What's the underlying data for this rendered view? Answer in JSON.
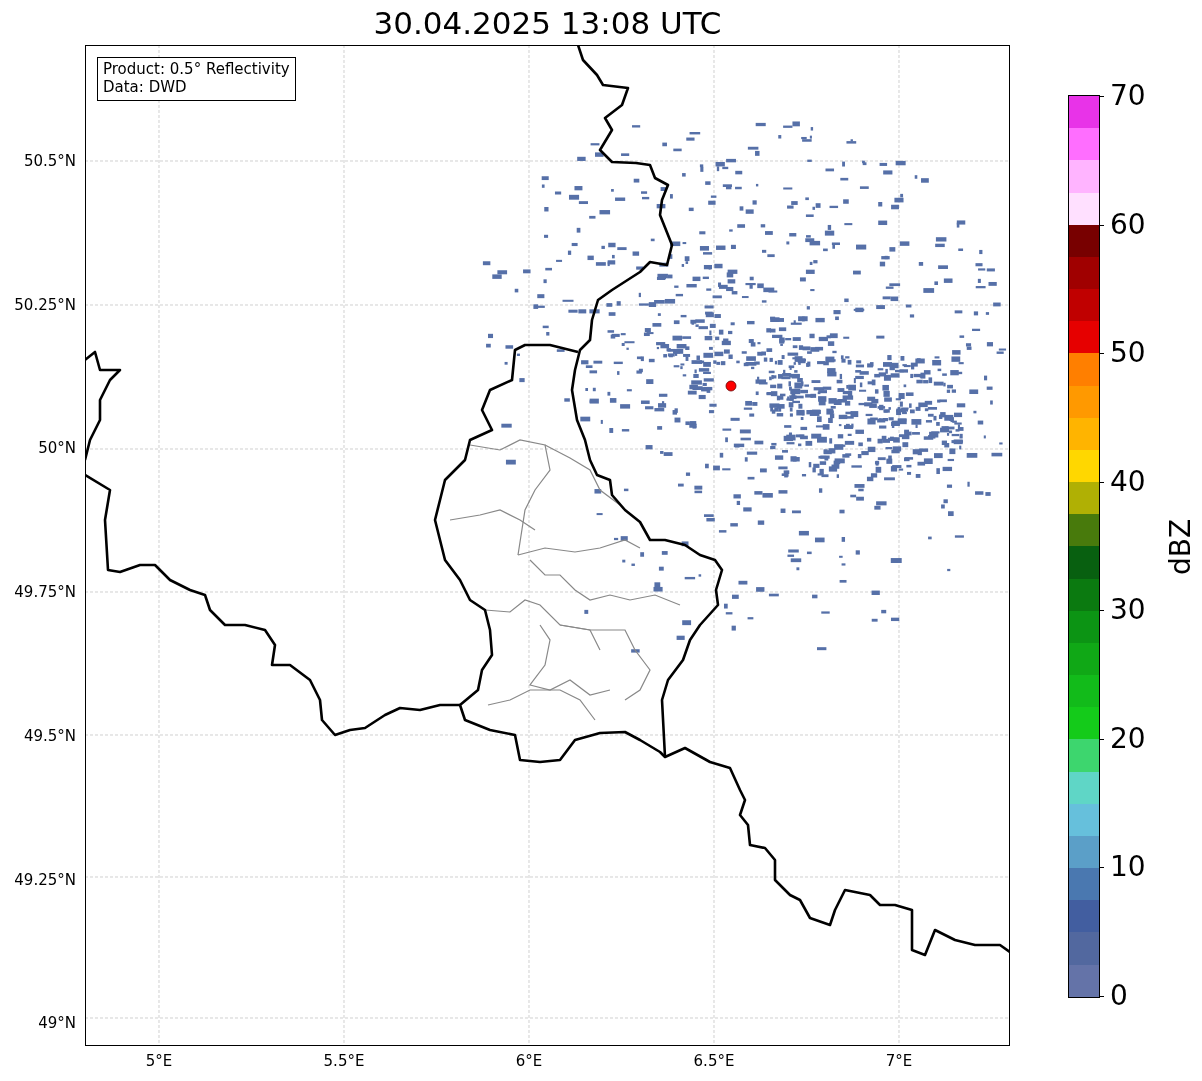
{
  "title": "30.04.2025 13:08 UTC",
  "legend": {
    "lines": [
      "Product: 0.5° Reflectivity",
      "Data: DWD"
    ]
  },
  "map": {
    "x_ticks": [
      "5°E",
      "5.5°E",
      "6°E",
      "6.5°E",
      "7°E"
    ],
    "y_ticks": [
      "50.5°N",
      "50.25°N",
      "50°N",
      "49.75°N",
      "49.5°N",
      "49.25°N",
      "49°N"
    ]
  },
  "colorbar": {
    "label": "dBZ",
    "ticks": [
      "70",
      "60",
      "50",
      "40",
      "30",
      "20",
      "10",
      "0"
    ],
    "segments": [
      {
        "color": "#e833e8"
      },
      {
        "color": "#ff6eff"
      },
      {
        "color": "#ffb4ff"
      },
      {
        "color": "#ffe0ff"
      },
      {
        "color": "#780000"
      },
      {
        "color": "#a00000"
      },
      {
        "color": "#c00000"
      },
      {
        "color": "#e60000"
      },
      {
        "color": "#ff7f00"
      },
      {
        "color": "#ff9900"
      },
      {
        "color": "#ffb400"
      },
      {
        "color": "#ffd700"
      },
      {
        "color": "#b0b004"
      },
      {
        "color": "#487a0c"
      },
      {
        "color": "#086010"
      },
      {
        "color": "#0b7a10"
      },
      {
        "color": "#0c9414"
      },
      {
        "color": "#10a816"
      },
      {
        "color": "#12bb1a"
      },
      {
        "color": "#14cb1a"
      },
      {
        "color": "#3dd66e"
      },
      {
        "color": "#5fd6c6"
      },
      {
        "color": "#66c0dc"
      },
      {
        "color": "#5b9fc8"
      },
      {
        "color": "#4a78b0"
      },
      {
        "color": "#425ea0"
      },
      {
        "color": "#52689f"
      },
      {
        "color": "#6473a8"
      }
    ]
  }
}
